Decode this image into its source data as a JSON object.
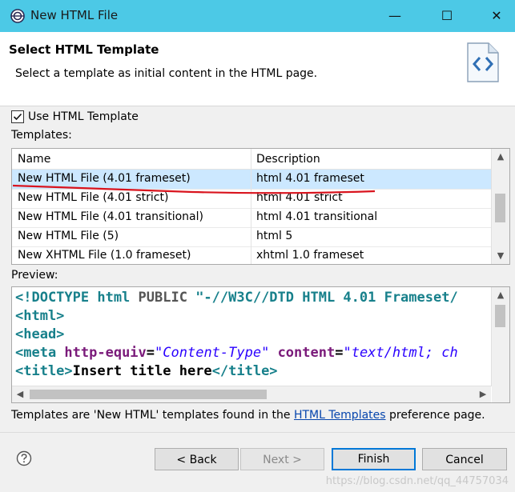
{
  "window": {
    "title": "New HTML File",
    "minimize": "—",
    "maximize": "☐",
    "close": "✕"
  },
  "header": {
    "title": "Select HTML Template",
    "subtitle": "Select a template as initial content in the HTML page."
  },
  "use_template": {
    "label": "Use HTML Template",
    "checked": true
  },
  "templates_label": "Templates:",
  "table": {
    "columns": [
      "Name",
      "Description"
    ],
    "rows": [
      {
        "name": "New HTML File (4.01 frameset)",
        "desc": "html 4.01 frameset",
        "selected": true
      },
      {
        "name": "New HTML File (4.01 strict)",
        "desc": "html 4.01 strict",
        "selected": false
      },
      {
        "name": "New HTML File (4.01 transitional)",
        "desc": "html 4.01 transitional",
        "selected": false
      },
      {
        "name": "New HTML File (5)",
        "desc": "html 5",
        "selected": false
      },
      {
        "name": "New XHTML File (1.0 frameset)",
        "desc": "xhtml 1.0 frameset",
        "selected": false
      }
    ]
  },
  "preview_label": "Preview:",
  "preview": {
    "l1_open": "<!DOCTYPE html ",
    "l1_kw": "PUBLIC ",
    "l1_str": "\"-//W3C//DTD HTML 4.01 Frameset/",
    "l2": "<html>",
    "l3": "<head>",
    "l4_tag": "<meta ",
    "l4_attr1": "http-equiv",
    "l4_eq1": "=",
    "l4_val1": "\"Content-Type\"",
    "l4_attr2": " content",
    "l4_eq2": "=",
    "l4_val2": "\"text/html; ch",
    "l5_open": "<title>",
    "l5_text": "Insert title here",
    "l5_close": "</title>"
  },
  "note": {
    "before": "Templates are 'New HTML' templates found in the ",
    "link": "HTML Templates",
    "after": " preference page."
  },
  "buttons": {
    "back": "< Back",
    "next": "Next >",
    "finish": "Finish",
    "cancel": "Cancel"
  },
  "watermark": "https://blog.csdn.net/qq_44757034"
}
